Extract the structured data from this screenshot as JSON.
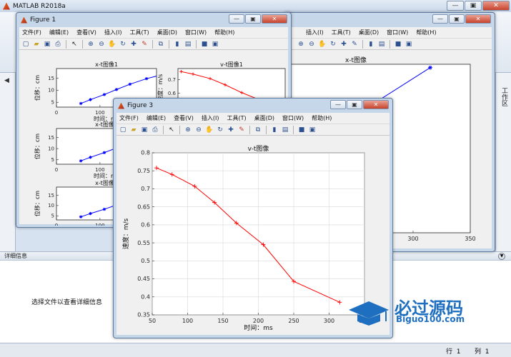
{
  "app": {
    "title": "MATLAB R2018a"
  },
  "detail_panel": {
    "header": "详细信息",
    "message": "选择文件以查看详细信息"
  },
  "right_panel": {
    "tab": "工作区"
  },
  "status": {
    "row_label": "行",
    "row_value": "1",
    "col_label": "列",
    "col_value": "1"
  },
  "figure_window": {
    "menu": [
      "文件(F)",
      "编辑(E)",
      "查看(V)",
      "插入(I)",
      "工具(T)",
      "桌面(D)",
      "窗口(W)",
      "帮助(H)"
    ],
    "caption_buttons": [
      "—",
      "▣",
      "✕"
    ]
  },
  "figure1": {
    "title": "Figure 1"
  },
  "figure3": {
    "title": "Figure 3"
  },
  "watermark": {
    "text_cn": "必过源码",
    "text_en": "Biguo100.com"
  },
  "chart_data": [
    {
      "id": "fig3-vt",
      "type": "line",
      "title": "v-t图像",
      "xlabel": "时间：ms",
      "ylabel": "速度：m/s",
      "xlim": [
        50,
        350
      ],
      "ylim": [
        0.35,
        0.8
      ],
      "xticks": [
        50,
        100,
        150,
        200,
        250,
        300,
        350
      ],
      "yticks": [
        0.35,
        0.4,
        0.45,
        0.5,
        0.55,
        0.6,
        0.65,
        0.7,
        0.75,
        0.8
      ],
      "grid": true,
      "color": "#ff0000",
      "marker": "+",
      "x": [
        56,
        78,
        110,
        138,
        169,
        207,
        250,
        315
      ],
      "y": [
        0.758,
        0.74,
        0.707,
        0.662,
        0.605,
        0.545,
        0.443,
        0.385
      ]
    },
    {
      "id": "fig2-xt-large",
      "type": "line",
      "title": "x-t图像",
      "xticks_visible": [
        250,
        300,
        350
      ],
      "color": "#0000ff",
      "marker": "*",
      "x": [
        210,
        250,
        315
      ],
      "y": [
        0.55,
        0.7,
        0.98
      ]
    },
    {
      "id": "fig1-xt1",
      "type": "line",
      "title": "x-t图像1",
      "xlabel": "时间：ms",
      "ylabel": "位移：cm",
      "xticks": [
        0,
        100,
        200
      ],
      "yticks": [
        5,
        10,
        15
      ],
      "xlim": [
        0,
        230
      ],
      "ylim": [
        3,
        19
      ],
      "color": "#0000ff",
      "marker": "*",
      "x": [
        56,
        78,
        110,
        138,
        169,
        207,
        250,
        315
      ],
      "y": [
        4.5,
        6.1,
        8.2,
        10.3,
        12.5,
        14.8,
        16.8,
        18.5
      ]
    },
    {
      "id": "fig1-vt1",
      "type": "line",
      "title": "v-t图像1",
      "ylabel": "速度：m/s",
      "yticks": [
        0.6,
        0.7
      ],
      "color": "#ff0000",
      "marker": "+",
      "x": [
        56,
        78,
        110,
        138,
        169,
        207
      ],
      "y": [
        0.758,
        0.74,
        0.707,
        0.662,
        0.605,
        0.545
      ]
    },
    {
      "id": "fig1-xt2",
      "type": "line",
      "title": "x-t图像2",
      "xlabel": "时间：ms",
      "ylabel": "位移：cm",
      "xticks": [
        0,
        100,
        200
      ],
      "yticks": [
        5,
        10,
        15
      ],
      "color": "#0000ff",
      "marker": "*",
      "x": [
        56,
        78,
        110,
        138,
        169,
        207,
        250,
        315
      ],
      "y": [
        4.5,
        6.1,
        8.2,
        10.3,
        12.5,
        14.8,
        16.8,
        18.5
      ]
    },
    {
      "id": "fig1-xt3",
      "type": "line",
      "title": "x-t图像3",
      "xlabel": "时间：ms",
      "ylabel": "位移：cm",
      "xticks": [
        0,
        100,
        200
      ],
      "yticks": [
        5,
        10,
        15
      ],
      "color": "#0000ff",
      "marker": "*",
      "x": [
        56,
        78,
        110,
        138,
        169,
        207,
        250,
        315
      ],
      "y": [
        4.5,
        6.1,
        8.2,
        10.3,
        12.5,
        14.8,
        16.8,
        18.5
      ]
    }
  ]
}
